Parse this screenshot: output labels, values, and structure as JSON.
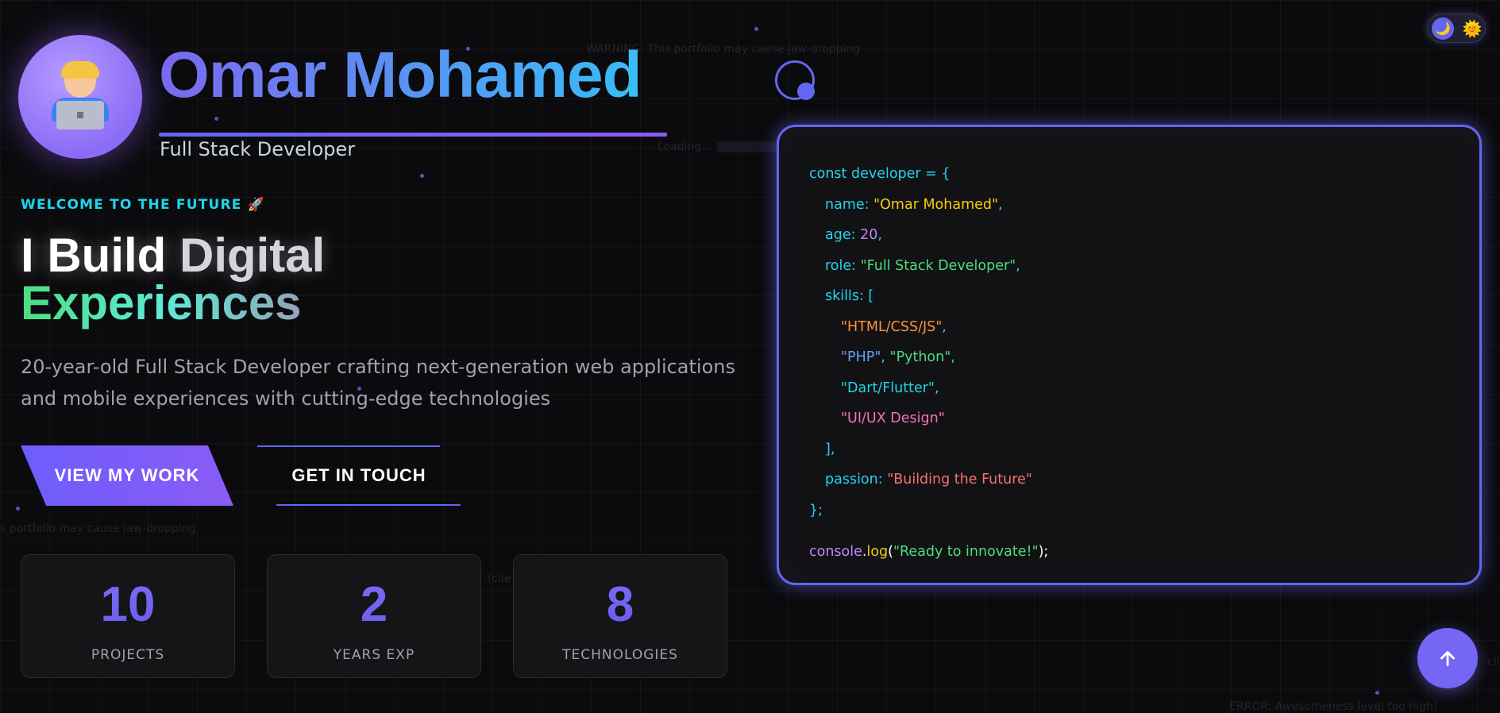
{
  "header": {
    "avatar_emoji": "🧑‍💻",
    "name": "Omar Mohamed",
    "subtitle": "Full Stack Developer"
  },
  "hero": {
    "welcome": "WELCOME TO THE FUTURE 🚀",
    "headline_part1": "I Build ",
    "headline_part2": "Digital",
    "headline_part3": "Experiences",
    "intro": "20-year-old Full Stack Developer crafting next-generation web applications and mobile experiences with cutting-edge technologies"
  },
  "buttons": {
    "view_work": "VIEW MY WORK",
    "get_in_touch": "GET IN TOUCH"
  },
  "stats": [
    {
      "value": "10",
      "label": "PROJECTS"
    },
    {
      "value": "2",
      "label": "YEARS EXP"
    },
    {
      "value": "8",
      "label": "TECHNOLOGIES"
    }
  ],
  "theme_toggle": {
    "moon": "🌙",
    "sun": "🌞",
    "active": "dark"
  },
  "code": {
    "l1": "const developer = {",
    "name_key": "name: ",
    "name_val": "\"Omar Mohamed\"",
    "age_key": "age: ",
    "age_val": "20",
    "role_key": "role: ",
    "role_val": "\"Full Stack Developer\"",
    "skills_key": "skills: [",
    "skill1": "\"HTML/CSS/JS\"",
    "skill2a": "\"PHP\"",
    "skill2b": "\"Python\"",
    "skill3": "\"Dart/Flutter\"",
    "skill4": "\"UI/UX Design\"",
    "skills_close": "],",
    "passion_key": "passion: ",
    "passion_val": "\"Building the Future\"",
    "close": "};",
    "console": "console",
    "log": "log",
    "log_arg": "\"Ready to innovate!\""
  },
  "background_text": {
    "t1": "WARNING: This portfolio may cause jaw-dropping",
    "t2": "Loading...",
    "t3": "s portfolio may cause jaw-dropping",
    "t4": "(clie",
    "t5": "ERROR: Awesomeness level too high!",
    "t6": "cli"
  },
  "scroll_top": {
    "icon": "arrow-up"
  }
}
